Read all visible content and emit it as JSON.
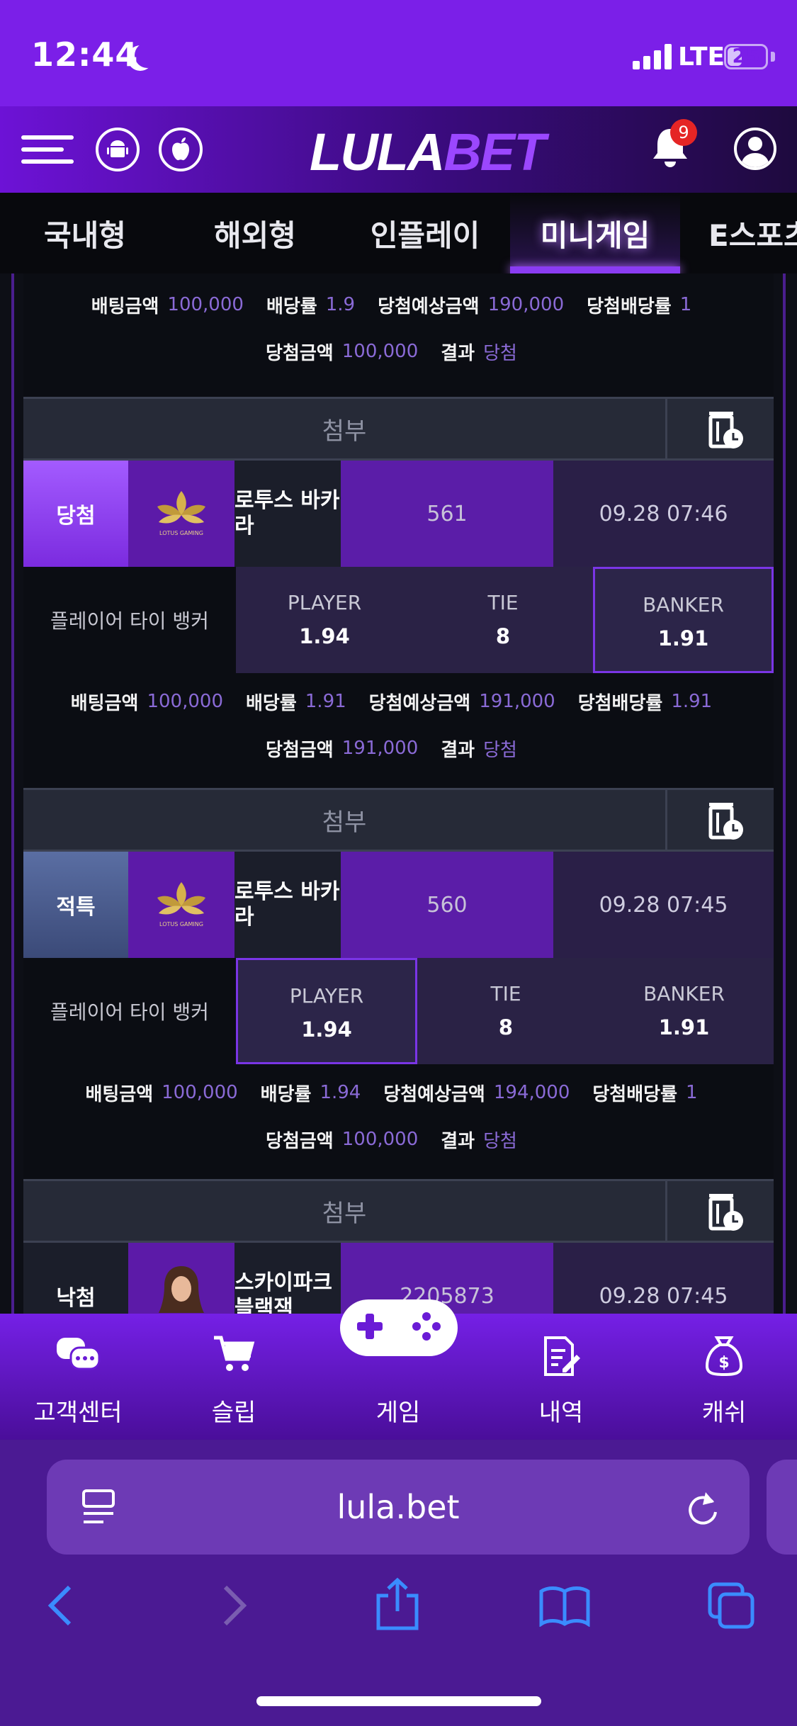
{
  "status_bar": {
    "time": "12:44",
    "network": "LTE",
    "battery": "25"
  },
  "header": {
    "logo_part1": "LULA",
    "logo_part2": "BET",
    "notification_count": "9"
  },
  "tabs": [
    {
      "label": "국내형"
    },
    {
      "label": "해외형"
    },
    {
      "label": "인플레이"
    },
    {
      "label": "미니게임",
      "active": true
    },
    {
      "label": "E스포츠"
    }
  ],
  "info_labels": {
    "bet_amount": "배팅금액",
    "odds": "배당률",
    "expected_win": "당첨예상금액",
    "win_odds": "당첨배당률",
    "win_amount": "당첨금액",
    "result": "결과"
  },
  "attach_label": "첨부",
  "bet_desc": "플레이어 타이 뱅커",
  "options": {
    "player": "PLAYER",
    "tie": "TIE",
    "banker": "BANKER"
  },
  "records": [
    {
      "info": {
        "bet_amount": "100,000",
        "odds": "1.9",
        "expected_win": "190,000",
        "win_odds": "1",
        "win_amount": "100,000",
        "result": "당첨"
      }
    },
    {
      "status": "당첨",
      "game": "로투스 바카라",
      "logo_text": "LOTUS GAMING",
      "round": "561",
      "time": "09.28 07:46",
      "odds": {
        "player": "1.94",
        "tie": "8",
        "banker": "1.91"
      },
      "selected": "banker",
      "info": {
        "bet_amount": "100,000",
        "odds": "1.91",
        "expected_win": "191,000",
        "win_odds": "1.91",
        "win_amount": "191,000",
        "result": "당첨"
      }
    },
    {
      "status": "적특",
      "game": "로투스 바카라",
      "logo_text": "LOTUS GAMING",
      "round": "560",
      "time": "09.28 07:45",
      "odds": {
        "player": "1.94",
        "tie": "8",
        "banker": "1.91"
      },
      "selected": "player",
      "info": {
        "bet_amount": "100,000",
        "odds": "1.94",
        "expected_win": "194,000",
        "win_odds": "1",
        "win_amount": "100,000",
        "result": "당첨"
      }
    },
    {
      "status": "낙첨",
      "game": "스카이파크 블랙잭",
      "round": "2205873",
      "time": "09.28 07:45"
    }
  ],
  "bottom_nav": [
    {
      "label": "고객센터",
      "icon": "chat-icon"
    },
    {
      "label": "슬립",
      "icon": "cart-icon"
    },
    {
      "label": "게임",
      "icon": "gamepad-icon"
    },
    {
      "label": "내역",
      "icon": "document-icon"
    },
    {
      "label": "캐쉬",
      "icon": "money-bag-icon"
    }
  ],
  "browser": {
    "url": "lula.bet"
  },
  "colors": {
    "accent": "#7b1fe8",
    "win": "#8a3cf2",
    "lose_bg": "#1b1e2a",
    "special_bg": "#4a5a8c",
    "result_text": "#8a6ad6"
  }
}
